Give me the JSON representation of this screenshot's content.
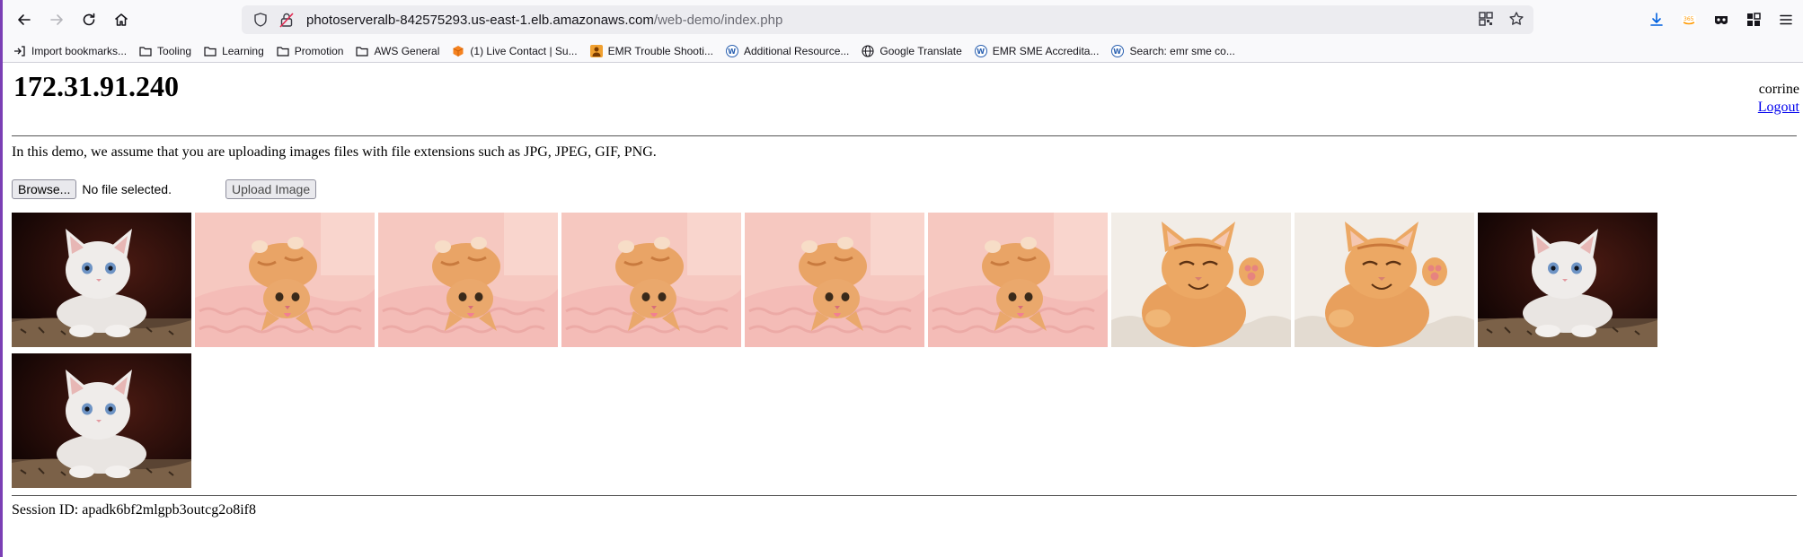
{
  "browser": {
    "url_host": "photoserveralb-842575293.us-east-1.elb.amazonaws.com",
    "url_path": "/web-demo/index.php",
    "bookmarks": [
      {
        "label": "Import bookmarks...",
        "icon": "import-icon"
      },
      {
        "label": "Tooling",
        "icon": "folder-icon"
      },
      {
        "label": "Learning",
        "icon": "folder-icon"
      },
      {
        "label": "Promotion",
        "icon": "folder-icon"
      },
      {
        "label": "AWS General",
        "icon": "folder-icon"
      },
      {
        "label": "(1) Live Contact | Su...",
        "icon": "cube-icon"
      },
      {
        "label": "EMR Trouble Shooti...",
        "icon": "person-icon"
      },
      {
        "label": "Additional Resource...",
        "icon": "wiki-icon"
      },
      {
        "label": "Google Translate",
        "icon": "globe-icon"
      },
      {
        "label": "EMR SME Accredita...",
        "icon": "wiki-icon"
      },
      {
        "label": "Search: emr sme co...",
        "icon": "wiki-icon"
      }
    ]
  },
  "page": {
    "ip_title": "172.31.91.240",
    "username": "corrine",
    "logout_label": "Logout",
    "intro": "In this demo, we assume that you are uploading images files with file extensions such as JPG, JPEG, GIF, PNG.",
    "browse_label": "Browse...",
    "file_status": "No file selected.",
    "upload_label": "Upload Image",
    "session_text": "Session ID: apadk6bf2mlgpb3outcg2o8if8",
    "images": [
      "white-kitten",
      "pink-blanket-kitten",
      "pink-blanket-kitten",
      "pink-blanket-kitten",
      "pink-blanket-kitten",
      "pink-blanket-kitten",
      "smiling-orange-kitten",
      "smiling-orange-kitten",
      "white-kitten",
      "white-kitten"
    ]
  }
}
